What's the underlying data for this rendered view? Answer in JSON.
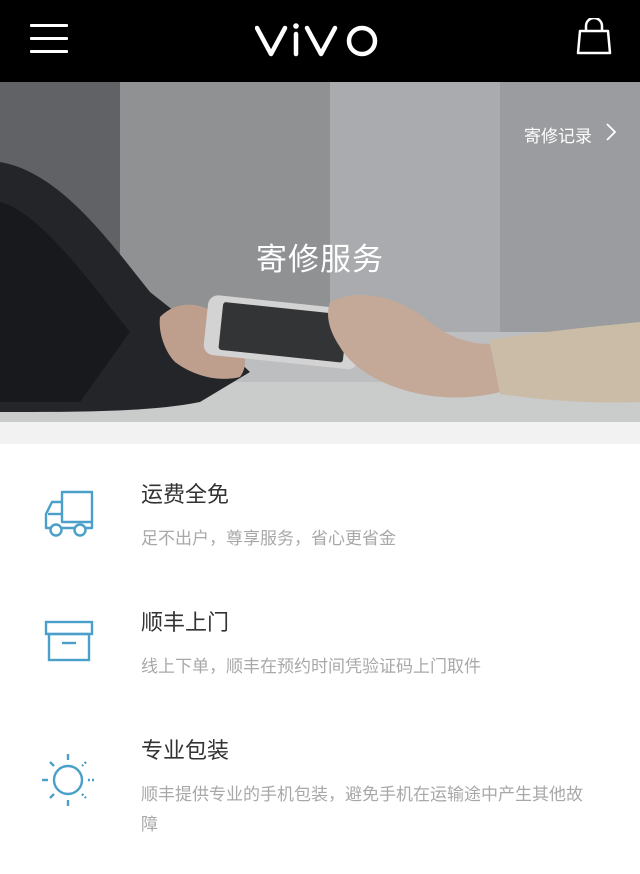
{
  "topbar": {
    "logo_text": "vivo",
    "menu_icon": "menu-icon",
    "cart_icon": "shopping-bag-icon"
  },
  "hero": {
    "title": "寄修服务",
    "record_link": "寄修记录",
    "record_chevron": "chevron-right-icon"
  },
  "features": [
    {
      "icon": "truck-icon",
      "title": "运费全免",
      "desc": "足不出户，尊享服务，省心更省金"
    },
    {
      "icon": "box-icon",
      "title": "顺丰上门",
      "desc": "线上下单，顺丰在预约时间凭验证码上门取件"
    },
    {
      "icon": "sun-icon",
      "title": "专业包装",
      "desc": "顺丰提供专业的手机包装，避免手机在运输途中产生其他故障"
    }
  ],
  "colors": {
    "topbar_bg": "#000000",
    "icon_accent": "#4aa0c8",
    "title_text": "#333333",
    "desc_text": "#a8a8a8",
    "separator": "#f2f2f2"
  }
}
